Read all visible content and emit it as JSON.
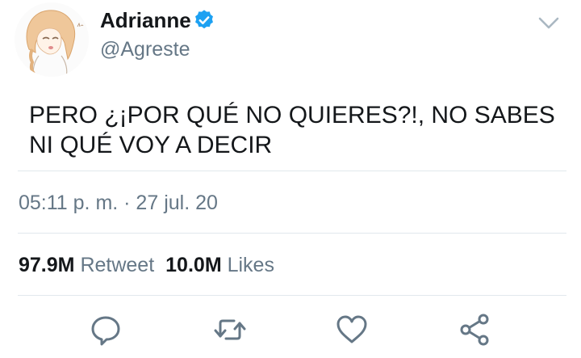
{
  "user": {
    "display_name": "Adrianne",
    "handle": "@Agreste",
    "verified": true
  },
  "tweet": {
    "text": "PERO ¿¡POR QUÉ NO QUIERES?!, NO SABES NI QUÉ VOY A DECIR",
    "timestamp": "05:11 p. m. · 27 jul. 20"
  },
  "stats": {
    "retweets_count": "97.9M",
    "retweets_label": "Retweet",
    "likes_count": "10.0M",
    "likes_label": "Likes"
  },
  "actions": [
    {
      "icon": "reply-icon"
    },
    {
      "icon": "retweet-icon"
    },
    {
      "icon": "like-icon"
    },
    {
      "icon": "share-icon"
    }
  ],
  "colors": {
    "text_primary": "#14171a",
    "text_secondary": "#657786",
    "verified_blue": "#1da1f2",
    "divider": "#e1e8ed"
  }
}
